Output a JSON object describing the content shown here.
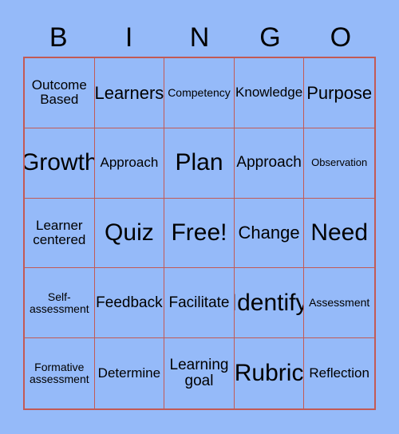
{
  "card": {
    "background_color": "#95baf9",
    "grid_line_color": "#c25a55",
    "text_color": "#000000"
  },
  "header": {
    "letters": [
      "B",
      "I",
      "N",
      "G",
      "O"
    ]
  },
  "grid": {
    "columns": 5,
    "rows": 5,
    "free_space": "Free!",
    "cells": [
      [
        {
          "text": "Outcome\nBased",
          "size": "md"
        },
        {
          "text": "Learners",
          "size": "xl"
        },
        {
          "text": "Competency",
          "size": "sm"
        },
        {
          "text": "Knowledge",
          "size": "md"
        },
        {
          "text": "Purpose",
          "size": "xl"
        }
      ],
      [
        {
          "text": "Growth",
          "size": "xxl"
        },
        {
          "text": "Approach",
          "size": "md"
        },
        {
          "text": "Plan",
          "size": "xxl"
        },
        {
          "text": "Approach",
          "size": "lg"
        },
        {
          "text": "Observation",
          "size": "xs"
        }
      ],
      [
        {
          "text": "Learner\ncentered",
          "size": "md"
        },
        {
          "text": "Quiz",
          "size": "xxl"
        },
        {
          "text": "Free!",
          "size": "xxl"
        },
        {
          "text": "Change",
          "size": "xl"
        },
        {
          "text": "Need",
          "size": "xxl"
        }
      ],
      [
        {
          "text": "Self-\nassessment",
          "size": "sm"
        },
        {
          "text": "Feedback",
          "size": "lg"
        },
        {
          "text": "Facilitate",
          "size": "lg"
        },
        {
          "text": "Identify",
          "size": "xxl"
        },
        {
          "text": "Assessment",
          "size": "sm"
        }
      ],
      [
        {
          "text": "Formative\nassessment",
          "size": "sm"
        },
        {
          "text": "Determine",
          "size": "md"
        },
        {
          "text": "Learning\ngoal",
          "size": "lg"
        },
        {
          "text": "Rubric",
          "size": "xxl"
        },
        {
          "text": "Reflection",
          "size": "md"
        }
      ]
    ]
  }
}
